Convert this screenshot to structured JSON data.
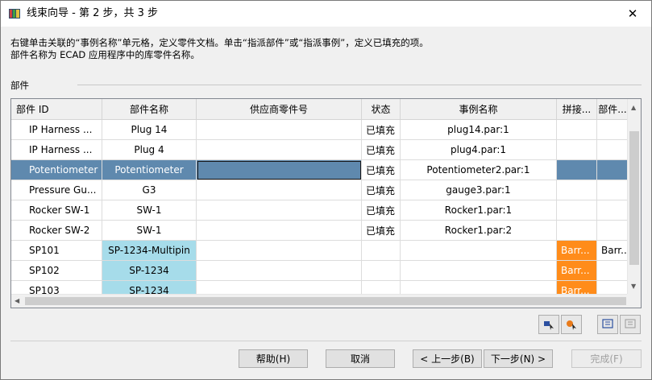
{
  "window": {
    "title": "线束向导 - 第 2 步，共 3 步",
    "close_symbol": "✕"
  },
  "instructions": {
    "line1": "右键单击关联的“事例名称”单元格，定义零件文档。单击“指派部件”或“指派事例”，定义已填充的项。",
    "line2": "部件名称为 ECAD 应用程序中的库零件名称。"
  },
  "group": {
    "label": "部件"
  },
  "grid": {
    "columns": [
      "部件 ID",
      "部件名称",
      "供应商零件号",
      "状态",
      "事例名称",
      "拼接...",
      "部件..."
    ],
    "rows": [
      {
        "id": "IP Harness ...",
        "name": "Plug 14",
        "vendor": "",
        "status": "已填充",
        "instance": "plug14.par:1",
        "splice": "",
        "part": ""
      },
      {
        "id": "IP Harness ...",
        "name": "Plug 4",
        "vendor": "",
        "status": "已填充",
        "instance": "plug4.par:1",
        "splice": "",
        "part": ""
      },
      {
        "id": "Potentiometer",
        "name": "Potentiometer",
        "vendor": "",
        "status": "已填充",
        "instance": "Potentiometer2.par:1",
        "splice": "",
        "part": ""
      },
      {
        "id": "Pressure Gu...",
        "name": "G3",
        "vendor": "",
        "status": "已填充",
        "instance": "gauge3.par:1",
        "splice": "",
        "part": ""
      },
      {
        "id": "Rocker SW-1",
        "name": "SW-1",
        "vendor": "",
        "status": "已填充",
        "instance": "Rocker1.par:1",
        "splice": "",
        "part": ""
      },
      {
        "id": "Rocker SW-2",
        "name": "SW-1",
        "vendor": "",
        "status": "已填充",
        "instance": "Rocker1.par:2",
        "splice": "",
        "part": ""
      },
      {
        "id": "SP101",
        "name": "SP-1234-Multipin",
        "vendor": "",
        "status": "",
        "instance": "",
        "splice": "Barr...",
        "part": "Barr..."
      },
      {
        "id": "SP102",
        "name": "SP-1234",
        "vendor": "",
        "status": "",
        "instance": "",
        "splice": "Barr...",
        "part": ""
      },
      {
        "id": "SP103",
        "name": "SP-1234",
        "vendor": "",
        "status": "",
        "instance": "",
        "splice": "Barr...",
        "part": ""
      }
    ],
    "selected_row": 2
  },
  "toolbar": {
    "assign_part_icon": "assign-part-icon",
    "assign_instance_icon": "assign-instance-icon",
    "view_icon": "view-icon",
    "list_icon": "list-icon"
  },
  "buttons": {
    "help": "帮助(H)",
    "cancel": "取消",
    "back": "< 上一步(B)",
    "next": "下一步(N) >",
    "finish": "完成(F)"
  },
  "colors": {
    "selection": "#5f89ae",
    "component_cell": "#a6dcea",
    "splice_cell": "#ff8c1a"
  }
}
